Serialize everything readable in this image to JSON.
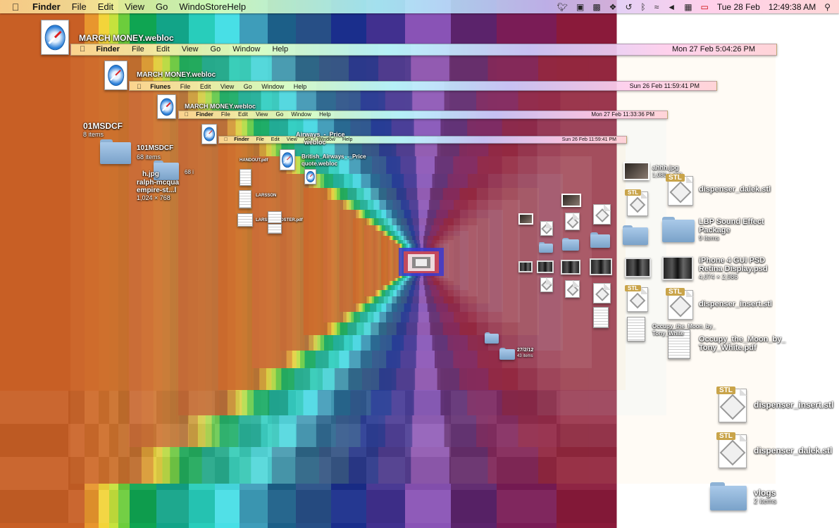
{
  "menubar": {
    "apple": "",
    "items": [
      "Finder",
      "File",
      "Edit",
      "View",
      "Go",
      "Windo",
      "Store",
      "Help"
    ],
    "date": "Tue 28 Feb",
    "time": "12:49:38 AM"
  },
  "nested_menubars": [
    {
      "items": [
        "Finder",
        "File",
        "Edit",
        "View",
        "Go",
        "Window",
        "Help"
      ],
      "datetime": "Mon 27 Feb  5:04:26 PM"
    },
    {
      "items": [
        "Fiunes",
        "File",
        "Edit",
        "View",
        "Go",
        "Window",
        "Help"
      ],
      "datetime": "Sun 26 Feb  11:59:41 PM"
    },
    {
      "items": [
        "Finder",
        "File",
        "Edit",
        "View",
        "Go",
        "Window",
        "Help"
      ],
      "datetime": "Mon 27 Feb  11:33:36 PM"
    },
    {
      "items": [
        "Finder",
        "File",
        "Edit",
        "View",
        "Go",
        "Window",
        "Help"
      ],
      "datetime": "Sun 26 Feb  11:59:41 PM"
    }
  ],
  "desktop_items": {
    "march_money": "MARCH MONEY.webloc",
    "march_money_2": "MARCH MONEY.webloc",
    "march_money_3": "MARCH MONEY.webloc",
    "f101msdcf_a": "01MSDCF",
    "f101msdcf_a_sub": "8 items",
    "f101msdcf_b": "101MSDCF",
    "f101msdcf_b_sub": "68 items",
    "f101msdcf_b_sub2": "68 i",
    "hjpg": "h.jpg",
    "ralph": "ralph-mcqua",
    "empire": "empire-st...l",
    "ralph_dim": "1,024 × 768",
    "british": "British_Airways_-_Price",
    "british2": "quote.webloc",
    "airways": "Airways_-_Price",
    "airways2": "webloc",
    "larsson": "LARSSON",
    "handout": "HANDOUT.pdf",
    "larsson_poster": "LARSSON POSTER.pdf",
    "ahhh": "ahhh.jpg",
    "ahhh_dim": "1,080 × 720",
    "dispenser_dalek": "dispenser_dalek.stl",
    "lbp": "LBP Sound Effect",
    "lbp2": "Package",
    "lbp_sub": "9 items",
    "iphone": "iPhone 4 GUI PSD",
    "iphone2": "Retina Display.psd",
    "iphone_dim": "4,074 × 2,986",
    "dispenser_insert": "dispenser_insert.stl",
    "occupy": "Occupy_the_Moon_by_",
    "occupy2": "Tony_White.pdf",
    "occupy_small": "Occupy_the_Moon_by_",
    "occupy_small2": "Tony_White",
    "dispenser_insert_big": "dispenser_insert.stl",
    "dispenser_dalek_big": "dispenser_dalek.stl",
    "vlogs": "vlogs",
    "vlogs_sub": "2 items",
    "folder_272": "27/2/12",
    "folder_272_sub": "43 items",
    "stl_tag": "STL"
  },
  "colors": {
    "stripes": [
      "#c85f25",
      "#e8962e",
      "#f1c02f",
      "#d8e23f",
      "#84d03a",
      "#16a954",
      "#14a580",
      "#23c9b8",
      "#47e0e8",
      "#4aa9c1",
      "#1f6b8f",
      "#2a5f8a",
      "#1a2f8a",
      "#3e2c8c",
      "#8a55b8",
      "#5e246e",
      "#7a1d55",
      "#8a1b3a"
    ]
  }
}
